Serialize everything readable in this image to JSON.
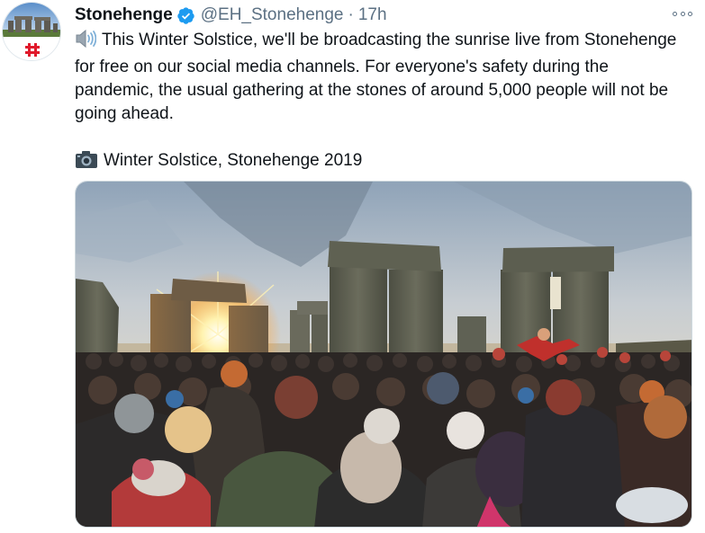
{
  "author": {
    "display_name": "Stonehenge",
    "handle": "@EH_Stonehenge",
    "separator": "·",
    "timestamp": "17h",
    "verified": true,
    "avatar_icon": "stonehenge-avatar-icon"
  },
  "tweet": {
    "speaker_icon": "speaker-high-volume-icon",
    "text": "This Winter Solstice, we'll be broadcasting the sunrise live from Stonehenge for free on our social media channels. For everyone's safety during the pandemic, the usual gathering at the stones of around 5,000 people will not be going ahead.",
    "camera_icon": "camera-icon",
    "caption": "Winter Solstice, Stonehenge 2019"
  },
  "media": {
    "type": "photo",
    "subject": "crowd-at-stonehenge-sunrise"
  },
  "colors": {
    "verified_blue": "#1d9bf0",
    "secondary_text": "#5b7083",
    "brand_red": "#e0192b"
  }
}
